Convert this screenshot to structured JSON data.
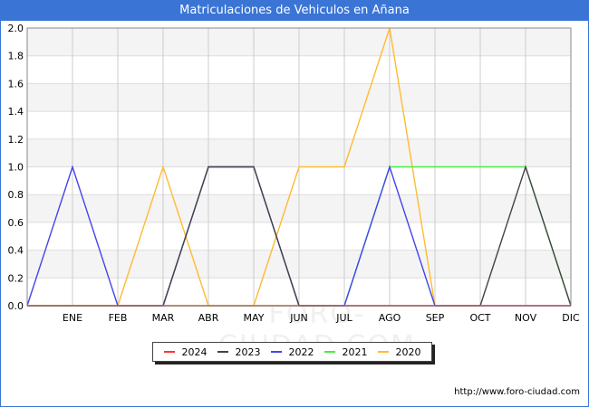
{
  "header": {
    "title": "Matriculaciones de Vehiculos en Añana"
  },
  "footer": {
    "source": "http://www.foro-ciudad.com"
  },
  "watermark": "FORO-CIUDAD.COM",
  "chart_data": {
    "type": "line",
    "title": "Matriculaciones de Vehiculos en Añana",
    "categories": [
      "",
      "ENE",
      "FEB",
      "MAR",
      "ABR",
      "MAY",
      "JUN",
      "JUL",
      "AGO",
      "SEP",
      "OCT",
      "NOV",
      "DIC"
    ],
    "ylim": [
      0,
      2.0
    ],
    "yticks": [
      "0.0",
      "0.2",
      "0.4",
      "0.6",
      "0.8",
      "1.0",
      "1.2",
      "1.4",
      "1.6",
      "1.8",
      "2.0"
    ],
    "grid": true,
    "legend_position": "bottom-center",
    "series": [
      {
        "name": "2024",
        "color": "#ff3333",
        "values": [
          0,
          0,
          0,
          0,
          0,
          0,
          0,
          0,
          0,
          0,
          0,
          0,
          0
        ]
      },
      {
        "name": "2023",
        "color": "#444444",
        "values": [
          0,
          0,
          0,
          0,
          1,
          1,
          0,
          0,
          0,
          0,
          0,
          1,
          0
        ]
      },
      {
        "name": "2022",
        "color": "#4444ee",
        "values": [
          0,
          1,
          0,
          0,
          1,
          1,
          0,
          0,
          1,
          0,
          0,
          0,
          0
        ]
      },
      {
        "name": "2021",
        "color": "#44ee44",
        "values": [
          0,
          0,
          0,
          0,
          0,
          0,
          0,
          0,
          1,
          1,
          1,
          1,
          0
        ]
      },
      {
        "name": "2020",
        "color": "#ffbb33",
        "values": [
          0,
          0,
          0,
          1,
          0,
          0,
          1,
          1,
          2,
          0,
          0,
          0,
          0
        ]
      }
    ]
  }
}
